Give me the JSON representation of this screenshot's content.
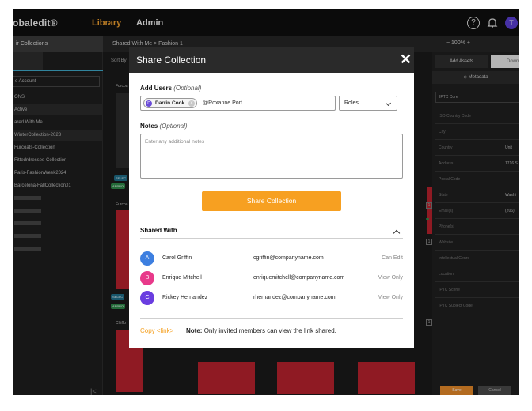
{
  "nav": {
    "logo": "obaledit®",
    "library": "Library",
    "admin": "Admin",
    "avatar_initial": "T"
  },
  "toolbar": {
    "collections": "ir Collections",
    "breadcrumb": "Shared With Me > Fashion 1",
    "zoom": "− 100% +"
  },
  "sidebar": {
    "account": "e Account",
    "items": [
      {
        "label": "ONS"
      },
      {
        "label": "Active"
      },
      {
        "label": "ared With Me"
      },
      {
        "label": "WinterCollection-2023"
      },
      {
        "label": "Furcoats-Collection"
      },
      {
        "label": "Fittedrdresses-Collection"
      },
      {
        "label": "Paris-FashionWeek2024"
      },
      {
        "label": "Barcelona-FallCollection01"
      }
    ]
  },
  "grid": {
    "sort_by": "Sort By:",
    "label_1": "Furcoa",
    "label_2": "Furcoa",
    "label_3": "Chiffo",
    "badge_select": "SELEC",
    "badge_approved": "APPRO",
    "stars": "★★★★★"
  },
  "right_panel": {
    "add_assets": "Add Assets",
    "download": "Down",
    "metadata": "Metadata",
    "schema": "IPTC Core",
    "rows": [
      {
        "label": "ISO Country Code",
        "value": ""
      },
      {
        "label": "City",
        "value": ""
      },
      {
        "label": "Country",
        "value": "Unit"
      },
      {
        "label": "Address",
        "value": "1716 S"
      },
      {
        "label": "Postal Code",
        "value": ""
      },
      {
        "label": "State",
        "value": "Washi"
      },
      {
        "label": "Email(s)",
        "value": "(206)"
      },
      {
        "label": "Phone(s)",
        "value": ""
      },
      {
        "label": "Website",
        "value": ""
      },
      {
        "label": "Intellectual Genre",
        "value": ""
      },
      {
        "label": "Location",
        "value": ""
      },
      {
        "label": "IPTC Scene",
        "value": ""
      },
      {
        "label": "IPTC Subject Code",
        "value": ""
      }
    ],
    "save": "Save",
    "cancel": "Cancel"
  },
  "modal": {
    "title": "Share Collection",
    "add_users_label": "Add Users",
    "optional": "(Optional)",
    "chip": {
      "initial": "D",
      "name": "Darrin Cook"
    },
    "users_input_value": "@Roxanne Port",
    "roles": "Roles",
    "notes_label": "Notes",
    "notes_placeholder": "Enter any additional notes",
    "share_button": "Share Collection",
    "shared_with": "Shared With",
    "members": [
      {
        "initial": "A",
        "name": "Carol Griffin",
        "email": "cgriffin@companyname.com",
        "role": "Can Edit",
        "color": "#3d7fe0"
      },
      {
        "initial": "B",
        "name": "Enrique Mitchell",
        "email": "enriquemitchell@companyname.com",
        "role": "View Only",
        "color": "#e8398a"
      },
      {
        "initial": "C",
        "name": "Rickey Hernandez",
        "email": "rhernandez@companyname.com",
        "role": "View Only",
        "color": "#6a3de0"
      }
    ],
    "copy_link": "Copy <link>",
    "note_bold": "Note:",
    "note_text": "Only invited members can view the link shared."
  }
}
